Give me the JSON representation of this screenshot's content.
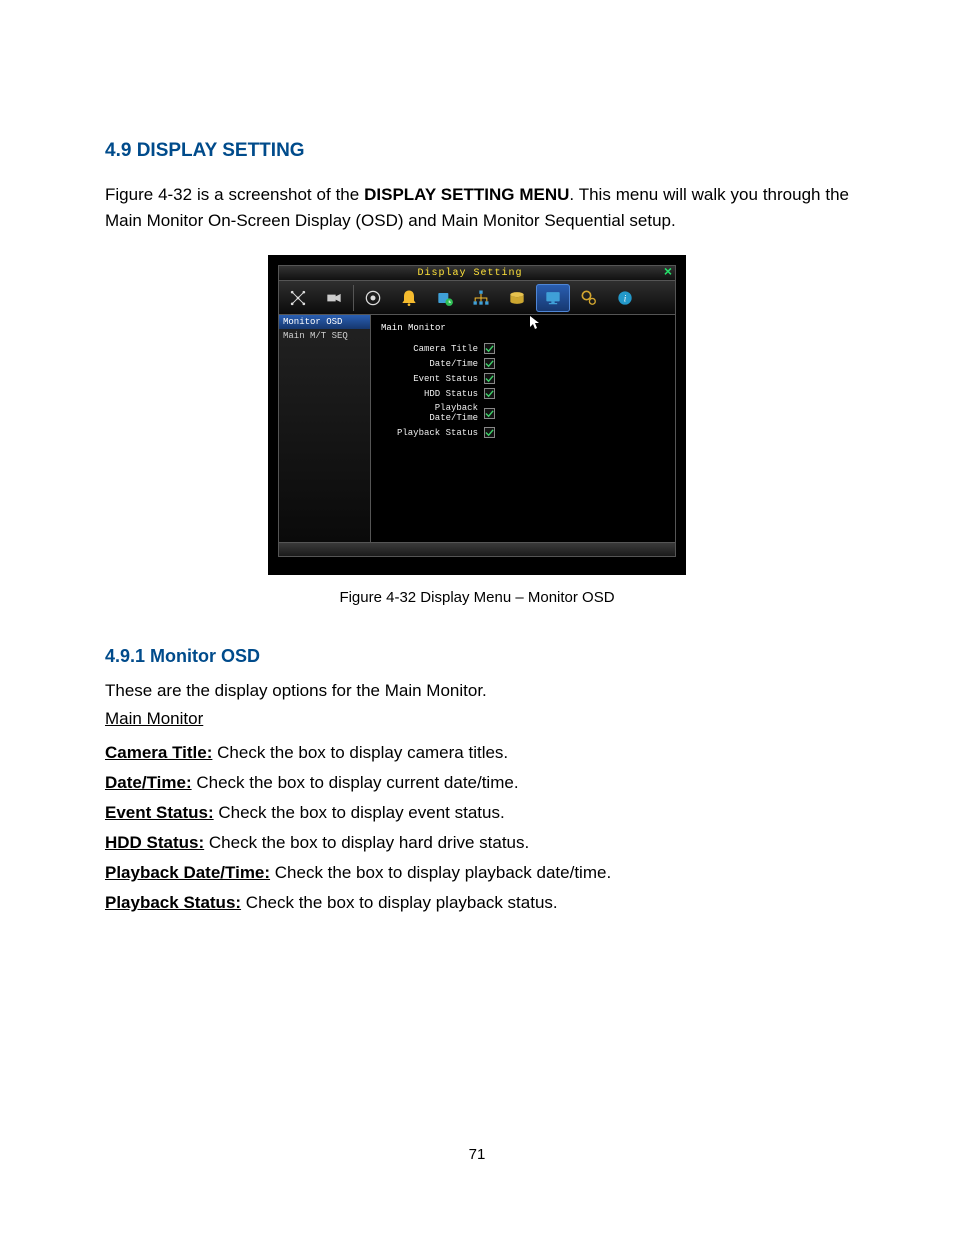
{
  "heading": "4.9 DISPLAY SETTING",
  "intro": {
    "pre": "Figure 4-32 is a screenshot of the ",
    "bold": "DISPLAY SETTING MENU",
    "post": ". This menu will walk you through the Main Monitor On-Screen Display (OSD) and Main Monitor Sequential setup."
  },
  "dialog": {
    "title": "Display Setting",
    "close": "×",
    "sidebar": [
      {
        "label": "Monitor OSD",
        "selected": true
      },
      {
        "label": "Main M/T SEQ",
        "selected": false
      }
    ],
    "content_title": "Main Monitor",
    "options": [
      {
        "label": "Camera Title",
        "checked": true
      },
      {
        "label": "Date/Time",
        "checked": true
      },
      {
        "label": "Event Status",
        "checked": true
      },
      {
        "label": "HDD Status",
        "checked": true
      },
      {
        "label": "Playback Date/Time",
        "checked": true
      },
      {
        "label": "Playback Status",
        "checked": true
      }
    ]
  },
  "caption": "Figure 4-32 Display Menu – Monitor OSD",
  "subsection": "4.9.1 Monitor OSD",
  "sentence": "These are the display options for the Main Monitor.",
  "main_monitor_hdr": "Main Monitor",
  "fields": [
    {
      "name": "Camera Title:",
      "desc": " Check the box to display camera titles."
    },
    {
      "name": "Date/Time:",
      "desc": " Check the box to display current date/time."
    },
    {
      "name": "Event Status:",
      "desc": " Check the box to display event status."
    },
    {
      "name": "HDD Status:",
      "desc": " Check the box to display hard drive status."
    },
    {
      "name": "Playback Date/Time:",
      "desc": " Check the box to display playback date/time."
    },
    {
      "name": "Playback Status:",
      "desc": " Check the box to display playback status."
    }
  ],
  "page_num": "71"
}
